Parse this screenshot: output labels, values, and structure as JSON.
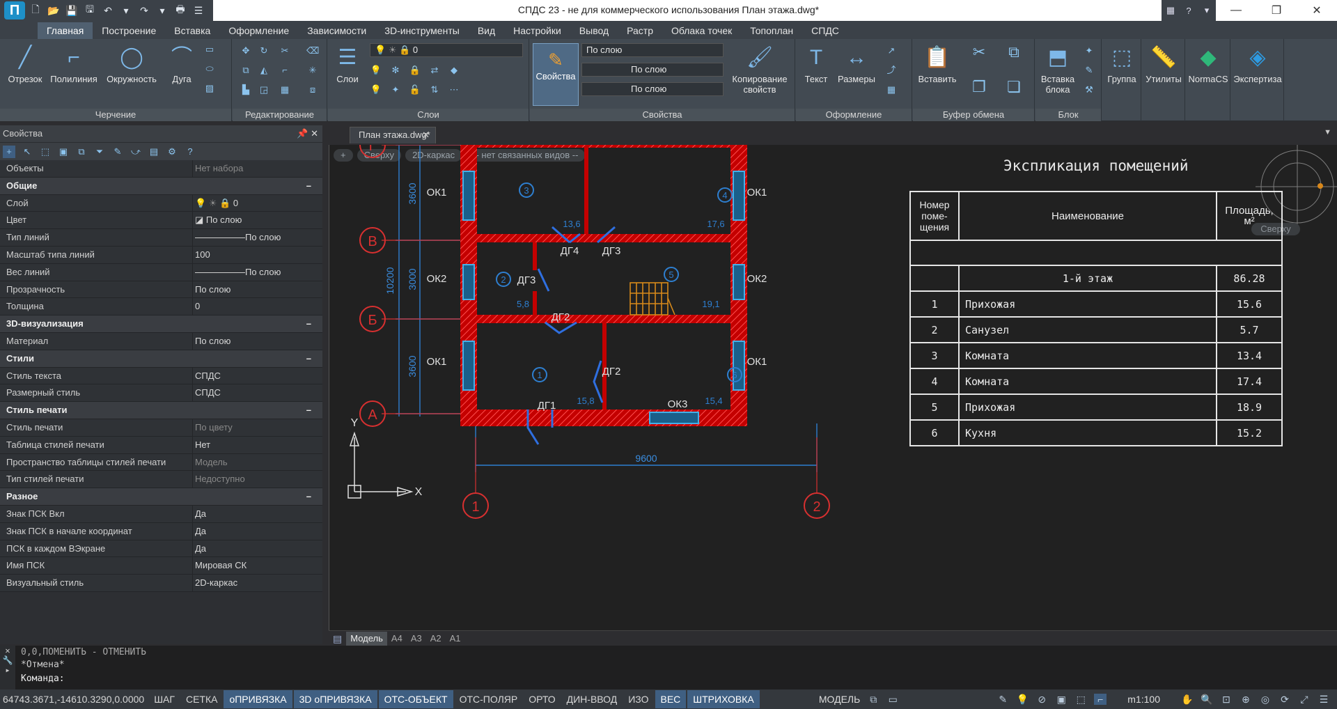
{
  "window": {
    "title": "СПДС 23 - не для коммерческого использования План этажа.dwg*",
    "help_label": "?"
  },
  "menu": [
    {
      "label": "Главная",
      "active": true
    },
    {
      "label": "Построение"
    },
    {
      "label": "Вставка"
    },
    {
      "label": "Оформление"
    },
    {
      "label": "Зависимости"
    },
    {
      "label": "3D-инструменты"
    },
    {
      "label": "Вид"
    },
    {
      "label": "Настройки"
    },
    {
      "label": "Вывод"
    },
    {
      "label": "Растр"
    },
    {
      "label": "Облака точек"
    },
    {
      "label": "Топоплан"
    },
    {
      "label": "СПДС"
    }
  ],
  "ribbon": {
    "draw": {
      "title": "Черчение",
      "line": "Отрезок",
      "polyline": "Полилиния",
      "circle": "Окружность",
      "arc": "Дуга"
    },
    "edit": {
      "title": "Редактирование"
    },
    "layers": {
      "title": "Слои",
      "layers_label": "Слои",
      "current_layer": "0"
    },
    "properties": {
      "title": "Свойства",
      "props_label": "Свойства",
      "color": "По слою",
      "linetype": "По слою",
      "lineweight": "По слою",
      "match_line1": "Копирование",
      "match_line2": "свойств"
    },
    "annotation": {
      "title": "Оформление",
      "text": "Текст",
      "dims": "Размеры"
    },
    "clipboard": {
      "title": "Буфер обмена",
      "paste": "Вставить"
    },
    "block": {
      "title": "Блок",
      "insert_line1": "Вставка",
      "insert_line2": "блока"
    },
    "group": "Группа",
    "utilities": "Утилиты",
    "normacs": "NormaCS",
    "expertise": "Экспертиза"
  },
  "properties_panel": {
    "title": "Свойства",
    "objects_label": "Объекты",
    "objects_value": "Нет набора",
    "sections": [
      {
        "title": "Общие",
        "rows": [
          {
            "key": "Слой",
            "value": "0"
          },
          {
            "key": "Цвет",
            "value": "По слою"
          },
          {
            "key": "Тип линий",
            "value": "По слою"
          },
          {
            "key": "Масштаб типа линий",
            "value": "100"
          },
          {
            "key": "Вес линий",
            "value": "По слою"
          },
          {
            "key": "Прозрачность",
            "value": "По слою"
          },
          {
            "key": "Толщина",
            "value": "0"
          }
        ]
      },
      {
        "title": "3D-визуализация",
        "rows": [
          {
            "key": "Материал",
            "value": "По слою"
          }
        ]
      },
      {
        "title": "Стили",
        "rows": [
          {
            "key": "Стиль текста",
            "value": "СПДС"
          },
          {
            "key": "Размерный стиль",
            "value": "СПДС"
          }
        ]
      },
      {
        "title": "Стиль печати",
        "rows": [
          {
            "key": "Стиль печати",
            "value": "По цвету"
          },
          {
            "key": "Таблица стилей печати",
            "value": "Нет"
          },
          {
            "key": "Пространство таблицы стилей печати",
            "value": "Модель"
          },
          {
            "key": "Тип стилей печати",
            "value": "Недоступно"
          }
        ]
      },
      {
        "title": "Разное",
        "rows": [
          {
            "key": "Знак ПСК Вкл",
            "value": "Да"
          },
          {
            "key": "Знак ПСК в начале координат",
            "value": "Да"
          },
          {
            "key": "ПСК в каждом ВЭкране",
            "value": "Да"
          },
          {
            "key": "Имя ПСК",
            "value": "Мировая СК"
          },
          {
            "key": "Визуальный стиль",
            "value": "2D-каркас"
          }
        ]
      }
    ],
    "collapse_glyph": "–"
  },
  "document": {
    "tab": "План этажа.dwg*"
  },
  "viewport": {
    "chips": [
      "+",
      "Сверху",
      "2D-каркас",
      "-- нет связанных видов --"
    ],
    "viewcube_label": "Сверху",
    "axes_letters": [
      "Г",
      "В",
      "Б",
      "А"
    ],
    "axes_numbers": [
      "1",
      "2"
    ],
    "dims": {
      "total_height": "10200",
      "total_width": "9600",
      "seg_top": "3600",
      "seg_mid": "3000",
      "seg_bot": "3600"
    },
    "windows": [
      "ОК1",
      "ОК2",
      "ОК1",
      "ОК1",
      "ОК2",
      "ОК1",
      "ОК3"
    ],
    "doors": [
      "ДГ4",
      "ДГ3",
      "ДГ3",
      "ДГ2",
      "ДГ2",
      "ДГ1"
    ],
    "rooms": [
      {
        "num": "3",
        "area": "13,6"
      },
      {
        "num": "4",
        "area": "17,6"
      },
      {
        "num": "2",
        "area": "5,8"
      },
      {
        "num": "5",
        "area": "19,1"
      },
      {
        "num": "1",
        "area": "15,8"
      },
      {
        "num": "6",
        "area": "15,4"
      }
    ],
    "ucs_y": "Y",
    "ucs_x": "X"
  },
  "explication": {
    "title": "Экспликация помещений",
    "headers": {
      "num_line1": "Номер",
      "num_line2": "поме-",
      "num_line3": "щения",
      "name": "Наименование",
      "area_line1": "Площадь,",
      "area_line2": "м²"
    },
    "floor": {
      "name": "1-й этаж",
      "area": "86.28"
    },
    "rows": [
      {
        "num": "1",
        "name": "Прихожая",
        "area": "15.6"
      },
      {
        "num": "2",
        "name": "Санузел",
        "area": "5.7"
      },
      {
        "num": "3",
        "name": "Комната",
        "area": "13.4"
      },
      {
        "num": "4",
        "name": "Комната",
        "area": "17.4"
      },
      {
        "num": "5",
        "name": "Прихожая",
        "area": "18.9"
      },
      {
        "num": "6",
        "name": "Кухня",
        "area": "15.2"
      }
    ]
  },
  "layout_tabs": [
    "Модель",
    "A4",
    "A3",
    "A2",
    "A1"
  ],
  "command": {
    "line1": "0,0,ПОМЕНИТЬ - ОТМЕНИТЬ",
    "line2": "*Отмена*",
    "prompt": "Команда:"
  },
  "status": {
    "coords": "64743.3671,-14610.3290,0.0000",
    "toggles": [
      {
        "label": "ШАГ",
        "on": false
      },
      {
        "label": "СЕТКА",
        "on": false
      },
      {
        "label": "оПРИВЯЗКА",
        "on": true
      },
      {
        "label": "3D оПРИВЯЗКА",
        "on": true
      },
      {
        "label": "ОТС-ОБЪЕКТ",
        "on": true
      },
      {
        "label": "ОТС-ПОЛЯР",
        "on": false
      },
      {
        "label": "ОРТО",
        "on": false
      },
      {
        "label": "ДИН-ВВОД",
        "on": false
      },
      {
        "label": "ИЗО",
        "on": false
      },
      {
        "label": "ВЕС",
        "on": true
      },
      {
        "label": "ШТРИХОВКА",
        "on": true
      }
    ],
    "space": "МОДЕЛЬ",
    "scale": "m1:100"
  }
}
